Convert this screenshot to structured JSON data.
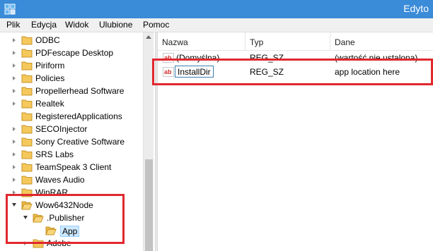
{
  "window": {
    "title": "Edyto"
  },
  "menu": {
    "items": [
      "Plik",
      "Edycja",
      "Widok",
      "Ulubione",
      "Pomoc"
    ]
  },
  "tree": {
    "items": [
      {
        "label": "ODBC",
        "expander": "collapsed"
      },
      {
        "label": "PDFescape Desktop",
        "expander": "collapsed"
      },
      {
        "label": "Piriform",
        "expander": "collapsed"
      },
      {
        "label": "Policies",
        "expander": "collapsed"
      },
      {
        "label": "Propellerhead Software",
        "expander": "collapsed"
      },
      {
        "label": "Realtek",
        "expander": "collapsed"
      },
      {
        "label": "RegisteredApplications",
        "expander": "none"
      },
      {
        "label": "SECOInjector",
        "expander": "collapsed"
      },
      {
        "label": "Sony Creative Software",
        "expander": "collapsed"
      },
      {
        "label": "SRS Labs",
        "expander": "collapsed"
      },
      {
        "label": "TeamSpeak 3 Client",
        "expander": "collapsed"
      },
      {
        "label": "Waves Audio",
        "expander": "collapsed"
      },
      {
        "label": "WinRAR",
        "expander": "collapsed"
      },
      {
        "label": "Wow6432Node",
        "expander": "expanded"
      },
      {
        "label": ".Publisher",
        "expander": "expanded"
      },
      {
        "label": "App",
        "expander": "none",
        "selected": true
      },
      {
        "label": "Adobe",
        "expander": "collapsed"
      }
    ]
  },
  "values": {
    "headers": {
      "name": "Nazwa",
      "type": "Typ",
      "data": "Dane"
    },
    "rows": [
      {
        "name": "(Domyślna)",
        "type": "REG_SZ",
        "data": "(wartość nie ustalona)"
      },
      {
        "name": "InstallDir",
        "type": "REG_SZ",
        "data": "app location here",
        "editing": true
      }
    ]
  },
  "colors": {
    "titlebar": "#3a8bd8",
    "highlight": "#e0282e",
    "selection": "#cce8ff",
    "folder": "#f4c85a"
  },
  "icons": {
    "app": "registry-editor-icon",
    "folder": "folder-icon",
    "string_value": "string-value-ab-icon"
  }
}
